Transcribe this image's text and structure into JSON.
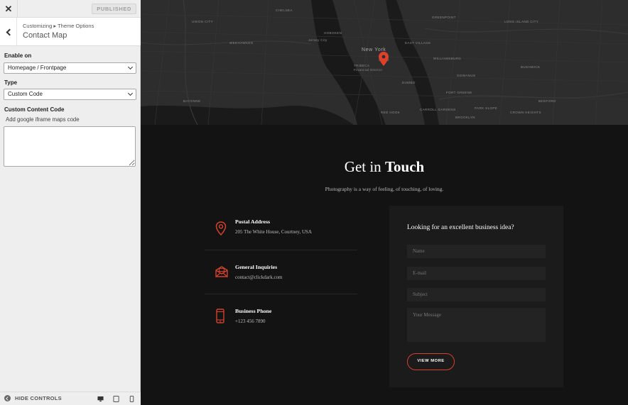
{
  "sidebar": {
    "close_label": "✕",
    "published_label": "PUBLISHED",
    "breadcrumb": "Customizing ▸ Theme Options",
    "section_title": "Contact Map",
    "enable_on": {
      "label": "Enable on",
      "value": "Homepage / Frontpage"
    },
    "type": {
      "label": "Type",
      "value": "Custom Code"
    },
    "custom_code": {
      "label": "Custom Content Code",
      "description": "Add google iframe maps code",
      "value": ""
    },
    "hide_controls_label": "HIDE CONTROLS"
  },
  "map": {
    "labels": [
      {
        "text": "New York",
        "big": true
      },
      {
        "text": "Jersey City"
      },
      {
        "text": "WILLIAMSBURG"
      },
      {
        "text": "BROOKLYN"
      },
      {
        "text": "GREENPOINT"
      },
      {
        "text": "SOHO"
      },
      {
        "text": "TRIBECA"
      },
      {
        "text": "HOBOKEN"
      },
      {
        "text": "EAST VILLAGE"
      },
      {
        "text": "DUMBO"
      },
      {
        "text": "BUSHWICK"
      },
      {
        "text": "RED HOOK"
      },
      {
        "text": "CARROLL GARDENS"
      },
      {
        "text": "FORT GREENE"
      },
      {
        "text": "WEEHAWKEN"
      },
      {
        "text": "LONG ISLAND CITY"
      },
      {
        "text": "BEDFORD"
      },
      {
        "text": "CHELSEA"
      },
      {
        "text": "UNION CITY"
      },
      {
        "text": "BAYONNE"
      },
      {
        "text": "PARK SLOPE"
      },
      {
        "text": "GOWANUS"
      },
      {
        "text": "CROWN HEIGHTS"
      },
      {
        "text": "Financial District"
      }
    ],
    "pin_color": "#e0402a"
  },
  "contact": {
    "heading_light": "Get in ",
    "heading_bold": "Touch",
    "subheading": "Photography is a way of feeling, of touching, of loving.",
    "items": [
      {
        "title": "Postal Address",
        "text": "205 The White House, Courtney, USA",
        "icon": "location-pin-icon"
      },
      {
        "title": "General Inquiries",
        "text": "contact@clickdark.com",
        "icon": "envelope-icon"
      },
      {
        "title": "Business Phone",
        "text": "+123 456 7890",
        "icon": "phone-icon"
      }
    ],
    "accent_color": "#d5412a"
  },
  "form": {
    "title": "Looking for an excellent business idea?",
    "name_placeholder": "Name",
    "email_placeholder": "E-mail",
    "subject_placeholder": "Subject",
    "message_placeholder": "Your Message",
    "button_label": "VIEW MORE"
  }
}
